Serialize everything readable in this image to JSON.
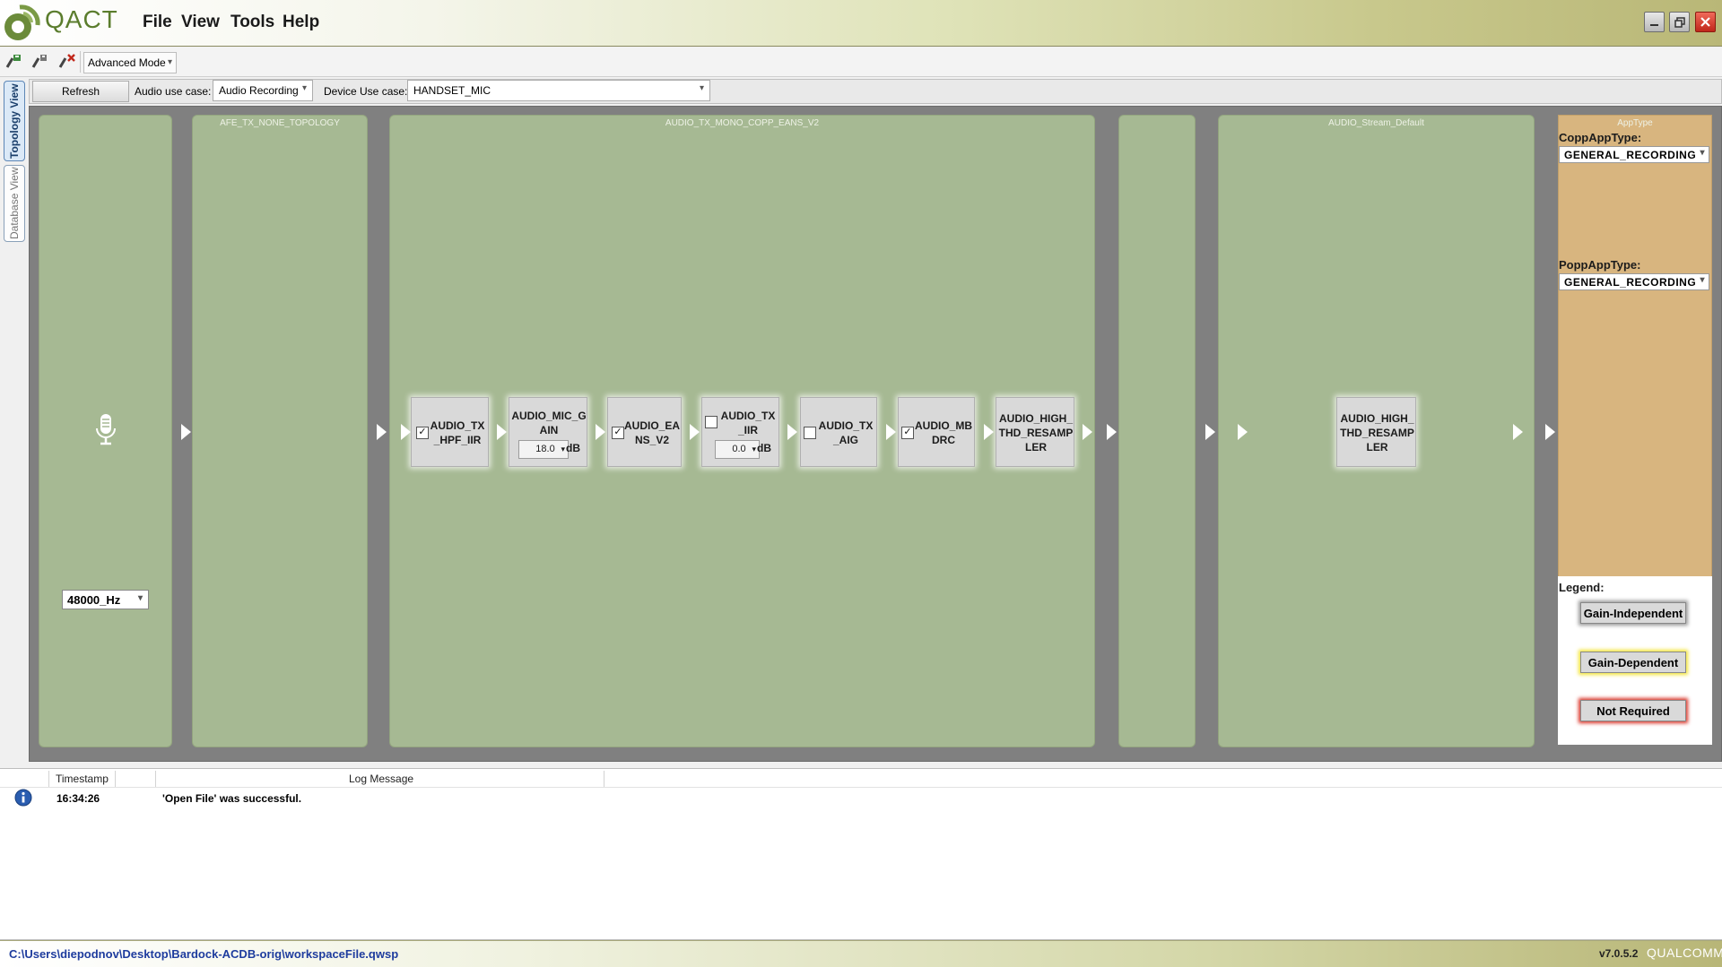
{
  "app": {
    "name": "QACT",
    "menu": [
      "File",
      "View",
      "Tools",
      "Help"
    ]
  },
  "toolbar": {
    "mode": "Advanced Mode",
    "icons": [
      "connect-icon",
      "disconnect-icon",
      "disconnect-x-icon"
    ]
  },
  "sidetabs": {
    "topology": "Topology View",
    "database": "Database View"
  },
  "filter": {
    "refresh_label": "Refresh",
    "audio_use_case_label": "Audio use case:",
    "audio_use_case_value": "Audio Recording",
    "device_use_case_label": "Device Use case:",
    "device_use_case_value": "HANDSET_MIC"
  },
  "graph": {
    "source": {
      "icon": "microphone-icon",
      "sample_rate": "48000_Hz"
    },
    "panels": {
      "afe": "AFE_TX_NONE_TOPOLOGY",
      "copp": "AUDIO_TX_MONO_COPP_EANS_V2",
      "stream": "AUDIO_Stream_Default"
    },
    "copp_modules": [
      {
        "label": "AUDIO_TX_HPF_IIR",
        "checkbox": true,
        "checked": true
      },
      {
        "label": "AUDIO_MIC_GAIN",
        "value": "18.0",
        "unit": "dB"
      },
      {
        "label": "AUDIO_EANS_V2",
        "checkbox": true,
        "checked": true
      },
      {
        "label": "AUDIO_TX_IIR",
        "checkbox": true,
        "checked": false,
        "value": "0.0",
        "unit": "dB"
      },
      {
        "label": "AUDIO_TX_AIG",
        "checkbox": true,
        "checked": false
      },
      {
        "label": "AUDIO_MBDRC",
        "checkbox": true,
        "checked": true
      },
      {
        "label": "AUDIO_HIGH_THD_RESAMPLER"
      }
    ],
    "stream_modules": [
      {
        "label": "AUDIO_HIGH_THD_RESAMPLER"
      }
    ]
  },
  "apptype": {
    "title": "AppType",
    "copp_label": "CoppAppType:",
    "copp_value": "GENERAL_RECORDING",
    "popp_label": "PoppAppType:",
    "popp_value": "GENERAL_RECORDING"
  },
  "legend": {
    "title": "Legend:",
    "items": [
      {
        "label": "Gain-Independent",
        "color": "#888888"
      },
      {
        "label": "Gain-Dependent",
        "color": "#f2e43a"
      },
      {
        "label": "Not Required",
        "color": "#d9362a"
      }
    ]
  },
  "log": {
    "headers": {
      "timestamp": "Timestamp",
      "message": "Log Message"
    },
    "rows": [
      {
        "icon": "info-icon",
        "timestamp": "16:34:26",
        "message": "'Open File' was successful."
      }
    ]
  },
  "status": {
    "path": "C:\\Users\\diepodnov\\Desktop\\Bardock-ACDB-orig\\workspaceFile.qwsp",
    "version": "v7.0.5.2",
    "vendor": "QUALCOMM"
  }
}
